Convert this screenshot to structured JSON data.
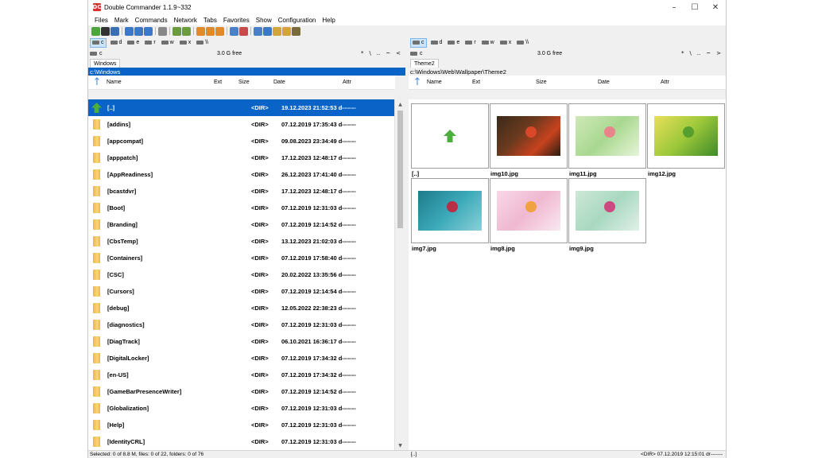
{
  "window": {
    "title": "Double Commander 1.1.9~332",
    "logo_text": "DC"
  },
  "window_controls": [
    "–",
    "☐",
    "✕"
  ],
  "menu": [
    "Files",
    "Mark",
    "Commands",
    "Network",
    "Tabs",
    "Favorites",
    "Show",
    "Configuration",
    "Help"
  ],
  "toolbar": {
    "groups": [
      [
        {
          "icon": "refresh-icon",
          "color": "#4fa43b"
        },
        {
          "icon": "terminal-icon",
          "color": "#333333"
        },
        {
          "icon": "search-icon",
          "color": "#3b6fb5"
        }
      ],
      [
        {
          "icon": "brief-view-icon",
          "color": "#3c78c8"
        },
        {
          "icon": "full-view-icon",
          "color": "#3c78c8"
        },
        {
          "icon": "thumbnail-view-icon",
          "color": "#3c78c8"
        }
      ],
      [
        {
          "icon": "swap-panels-icon",
          "color": "#888888"
        }
      ],
      [
        {
          "icon": "copy-left-icon",
          "color": "#6a9b3c"
        },
        {
          "icon": "copy-right-icon",
          "color": "#6a9b3c"
        }
      ],
      [
        {
          "icon": "pack-icon",
          "color": "#e08a2a"
        },
        {
          "icon": "unpack-icon",
          "color": "#e08a2a"
        },
        {
          "icon": "test-archive-icon",
          "color": "#e08a2a"
        }
      ],
      [
        {
          "icon": "sync-dirs-icon",
          "color": "#4a80c8"
        },
        {
          "icon": "run-icon",
          "color": "#c84a4a"
        }
      ],
      [
        {
          "icon": "open-folder-icon",
          "color": "#4a80c8"
        },
        {
          "icon": "view-icon",
          "color": "#3c78c8"
        },
        {
          "icon": "edit-icon",
          "color": "#d2a53c"
        },
        {
          "icon": "note-icon",
          "color": "#d2a53c"
        },
        {
          "icon": "archive-icon",
          "color": "#7a6a3a"
        }
      ]
    ]
  },
  "left": {
    "drives": [
      "c",
      "d",
      "e",
      "r",
      "w",
      "x",
      "\\\\"
    ],
    "active_drive": "c",
    "drive_label": "c",
    "free_space": "3.0 G free",
    "nav": [
      "*",
      "\\",
      "..",
      "~",
      "<"
    ],
    "tab": "Windows",
    "path": "c:\\Windows",
    "columns": {
      "name": "Name",
      "ext": "Ext",
      "size": "Size",
      "date": "Date",
      "attr": "Attr"
    },
    "rows": [
      {
        "name": "[..]",
        "size": "<DIR>",
        "date": "19.12.2023 21:52:53 d-------",
        "up": true,
        "selected": true
      },
      {
        "name": "[addins]",
        "size": "<DIR>",
        "date": "07.12.2019 17:35:43 d-------"
      },
      {
        "name": "[appcompat]",
        "size": "<DIR>",
        "date": "09.08.2023 23:34:49 d-------"
      },
      {
        "name": "[apppatch]",
        "size": "<DIR>",
        "date": "17.12.2023 12:48:17 d-------"
      },
      {
        "name": "[AppReadiness]",
        "size": "<DIR>",
        "date": "26.12.2023 17:41:40 d-------"
      },
      {
        "name": "[bcastdvr]",
        "size": "<DIR>",
        "date": "17.12.2023 12:48:17 d-------"
      },
      {
        "name": "[Boot]",
        "size": "<DIR>",
        "date": "07.12.2019 12:31:03 d-------"
      },
      {
        "name": "[Branding]",
        "size": "<DIR>",
        "date": "07.12.2019 12:14:52 d-------"
      },
      {
        "name": "[CbsTemp]",
        "size": "<DIR>",
        "date": "13.12.2023 21:02:03 d-------"
      },
      {
        "name": "[Containers]",
        "size": "<DIR>",
        "date": "07.12.2019 17:58:40 d-------"
      },
      {
        "name": "[CSC]",
        "size": "<DIR>",
        "date": "20.02.2022 13:35:56 d-------"
      },
      {
        "name": "[Cursors]",
        "size": "<DIR>",
        "date": "07.12.2019 12:14:54 d-------"
      },
      {
        "name": "[debug]",
        "size": "<DIR>",
        "date": "12.05.2022 22:38:23 d-------"
      },
      {
        "name": "[diagnostics]",
        "size": "<DIR>",
        "date": "07.12.2019 12:31:03 d-------"
      },
      {
        "name": "[DiagTrack]",
        "size": "<DIR>",
        "date": "06.10.2021 16:36:17 d-------"
      },
      {
        "name": "[DigitalLocker]",
        "size": "<DIR>",
        "date": "07.12.2019 17:34:32 d-------"
      },
      {
        "name": "[en-US]",
        "size": "<DIR>",
        "date": "07.12.2019 17:34:32 d-------"
      },
      {
        "name": "[GameBarPresenceWriter]",
        "size": "<DIR>",
        "date": "07.12.2019 12:14:52 d-------"
      },
      {
        "name": "[Globalization]",
        "size": "<DIR>",
        "date": "07.12.2019 12:31:03 d-------"
      },
      {
        "name": "[Help]",
        "size": "<DIR>",
        "date": "07.12.2019 12:31:03 d-------"
      },
      {
        "name": "[IdentityCRL]",
        "size": "<DIR>",
        "date": "07.12.2019 12:31:03 d-------"
      }
    ],
    "status": "Selected: 0 of 8.8 M, files: 0 of 22, folders: 0 of 76"
  },
  "right": {
    "drives": [
      "c",
      "d",
      "e",
      "r",
      "w",
      "x",
      "\\\\"
    ],
    "active_drive": "c",
    "drive_label": "c",
    "free_space": "3.0 G free",
    "nav": [
      "*",
      "\\",
      "..",
      "~",
      ">"
    ],
    "tab": "Theme2",
    "path": "c:\\Windows\\Web\\Wallpaper\\Theme2",
    "columns": {
      "name": "Name",
      "ext": "Ext",
      "size": "Size",
      "date": "Date",
      "attr": "Attr"
    },
    "thumbnails": [
      {
        "label": "[..]",
        "up": true
      },
      {
        "label": "img10.jpg",
        "bg": "linear-gradient(135deg,#3a2a1a 0%,#6b3a1e 40%,#c8421e 70%,#2a1e12 100%)",
        "accent": "#e2482a"
      },
      {
        "label": "img11.jpg",
        "bg": "linear-gradient(135deg,#cfe8b8 0%,#a8d890 50%,#e8f4d8 100%)",
        "accent": "#f07a8a"
      },
      {
        "label": "img12.jpg",
        "bg": "linear-gradient(135deg,#e8e05a 0%,#9cc83a 50%,#3e8a2a 100%)",
        "accent": "#4e9a2e"
      },
      {
        "label": "img7.jpg",
        "bg": "linear-gradient(135deg,#1e7a8a 0%,#3aa8b8 50%,#8ad0d8 100%)",
        "accent": "#c8203a"
      },
      {
        "label": "img8.jpg",
        "bg": "linear-gradient(135deg,#f8d8e8 0%,#f0b8d0 50%,#f8e8f0 100%)",
        "accent": "#f0a030"
      },
      {
        "label": "img9.jpg",
        "bg": "linear-gradient(135deg,#cfe8d8 0%,#a8d8c0 50%,#e0f0e8 100%)",
        "accent": "#d03a7a"
      }
    ],
    "status_left": "[..]",
    "status_right": "<DIR>  07.12.2019 12:15:01  dr-------"
  }
}
